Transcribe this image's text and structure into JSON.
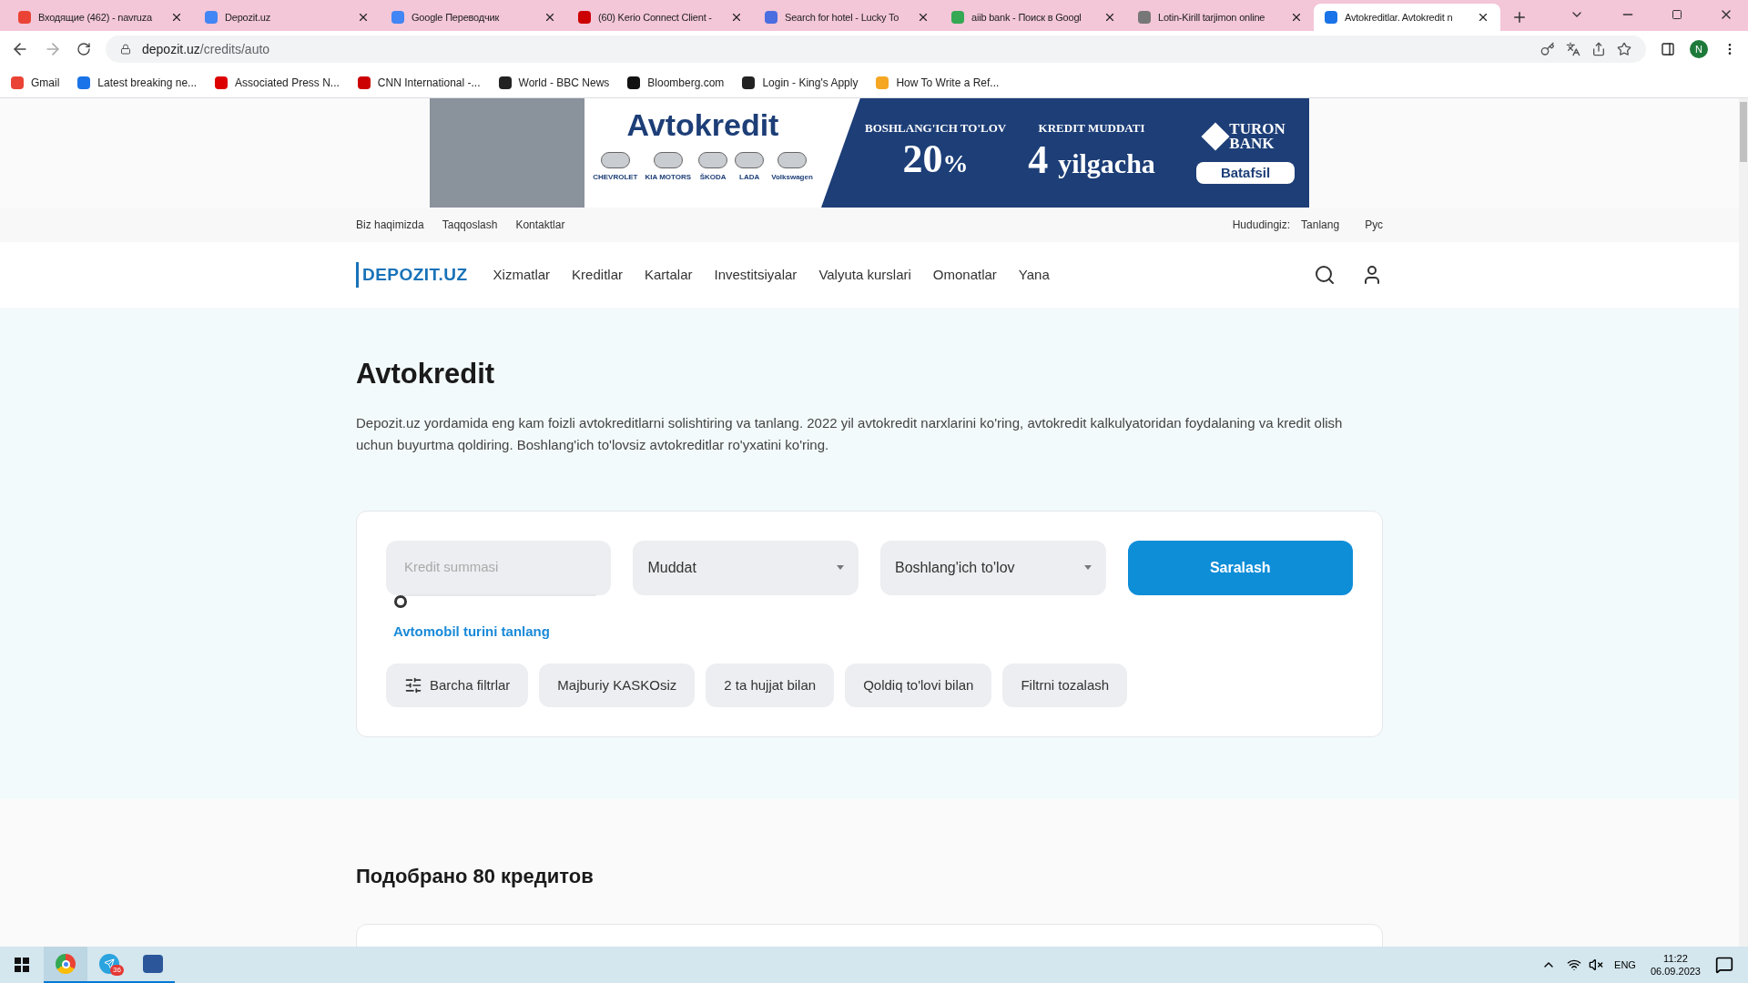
{
  "browser": {
    "tabs": [
      {
        "title": "Входящие (462) - navruza",
        "selected": false
      },
      {
        "title": "Depozit.uz",
        "selected": false
      },
      {
        "title": "Google Переводчик",
        "selected": false
      },
      {
        "title": "(60) Kerio Connect Client -",
        "selected": false
      },
      {
        "title": "Search for hotel - Lucky To",
        "selected": false
      },
      {
        "title": "aiib bank - Поиск в Googl",
        "selected": false
      },
      {
        "title": "Lotin-Kirill tarjimon online",
        "selected": false
      },
      {
        "title": "Avtokreditlar. Avtokredit n",
        "selected": true
      }
    ],
    "address": {
      "host": "depozit.uz",
      "path": "/credits/auto"
    },
    "profile_initial": "N",
    "bookmarks": [
      "Gmail",
      "Latest breaking ne...",
      "Associated Press N...",
      "CNN International -...",
      "World - BBC News",
      "Bloomberg.com",
      "Login - King's Apply",
      "How To Write a Ref..."
    ]
  },
  "banner": {
    "title": "Avtokredit",
    "brands": [
      "CHEVROLET",
      "KIA MOTORS",
      "ŠKODA",
      "LADA",
      "Volkswagen"
    ],
    "down_label": "BOSHLANG'ICH TO'LOV",
    "down_value": "20",
    "down_unit": "%",
    "term_label": "KREDIT MUDDATI",
    "term_value": "4",
    "term_unit": "yilgacha",
    "bank_lines": [
      "TURON",
      "BANK"
    ],
    "button": "Batafsil"
  },
  "top_links": [
    "Biz haqimizda",
    "Taqqoslash",
    "Kontaktlar"
  ],
  "region": {
    "label": "Hududingiz:",
    "value": "Tanlang"
  },
  "language": "Рус",
  "logo": "DEPOZIT.UZ",
  "nav": [
    "Xizmatlar",
    "Kreditlar",
    "Kartalar",
    "Investitsiyalar",
    "Valyuta kurslari",
    "Omonatlar",
    "Yana"
  ],
  "page": {
    "title": "Avtokredit",
    "description": "Depozit.uz yordamida eng kam foizli avtokreditlarni solishtiring va tanlang. 2022 yil avtokredit narxlarini ko'ring, avtokredit kalkulyatoridan foydalaning va kredit olish uchun buyurtma qoldiring. Boshlang'ich to'lovsiz avtokreditlar ro'yxatini ko'ring."
  },
  "filter": {
    "amount": {
      "placeholder": "Kredit summasi",
      "level": 0
    },
    "selects": [
      "Muddat",
      "Boshlang'ich to'lov"
    ],
    "submit": "Saralash",
    "car_type_link": "Avtomobil turini tanlang",
    "chips": [
      {
        "label": "Barcha filtrlar",
        "kind": "filters"
      },
      {
        "label": "Majburiy KASKOsiz",
        "kind": "plain"
      },
      {
        "label": "2 ta hujjat bilan",
        "kind": "plain"
      },
      {
        "label": "Qoldiq to'lovi bilan",
        "kind": "plain"
      },
      {
        "label": "Filtrni tozalash",
        "kind": "plain"
      }
    ]
  },
  "results": {
    "heading": "Подобрано 80 кредитов"
  },
  "taskbar": {
    "telegram_badge": "36",
    "language": "ENG",
    "time": "11:22",
    "date": "06.09.2023"
  }
}
